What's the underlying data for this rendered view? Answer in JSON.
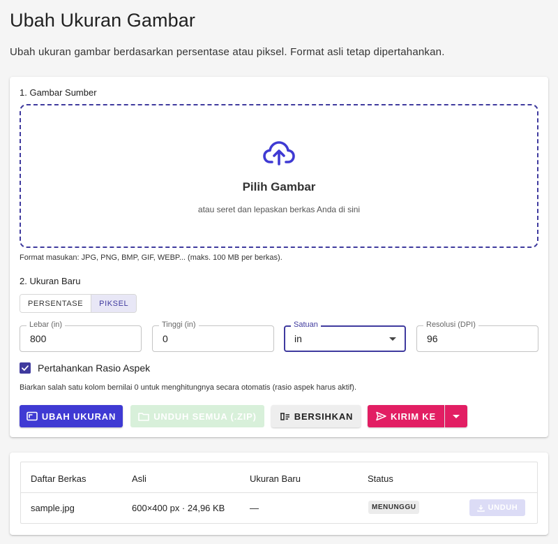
{
  "header": {
    "title": "Ubah Ukuran Gambar",
    "description": "Ubah ukuran gambar berdasarkan persentase atau piksel. Format asli tetap dipertahankan."
  },
  "source": {
    "section_label": "1. Gambar Sumber",
    "dropzone_title": "Pilih Gambar",
    "dropzone_subtitle": "atau seret dan lepaskan berkas Anda di sini",
    "formats_hint": "Format masukan: JPG, PNG, BMP, GIF, WEBP... (maks. 100 MB per berkas)."
  },
  "resize": {
    "section_label": "2. Ukuran Baru",
    "mode_percent": "PERSENTASE",
    "mode_pixel": "PIKSEL",
    "active_mode": "PIKSEL",
    "width_label": "Lebar (in)",
    "width_value": "800",
    "height_label": "Tinggi (in)",
    "height_value": "0",
    "unit_label": "Satuan",
    "unit_value": "in",
    "dpi_label": "Resolusi (DPI)",
    "dpi_value": "96",
    "keep_ratio_label": "Pertahankan Rasio Aspek",
    "keep_ratio_checked": true,
    "zero_hint": "Biarkan salah satu kolom bernilai 0 untuk menghitungnya secara otomatis (rasio aspek harus aktif)."
  },
  "actions": {
    "resize_label": "UBAH UKURAN",
    "download_all_label": "UNDUH SEMUA (.ZIP)",
    "clear_label": "BERSIHKAN",
    "send_label": "KIRIM KE"
  },
  "files": {
    "columns": [
      "Daftar Berkas",
      "Asli",
      "Ukuran Baru",
      "Status"
    ],
    "rows": [
      {
        "name": "sample.jpg",
        "original": "600×400 px · 24,96 KB",
        "new_size": "—",
        "status": "MENUNGGU",
        "download_label": "UNDUH"
      }
    ]
  },
  "colors": {
    "primary": "#3f3ad3",
    "accent": "#e21e63",
    "success_disabled": "#d8f0da"
  }
}
